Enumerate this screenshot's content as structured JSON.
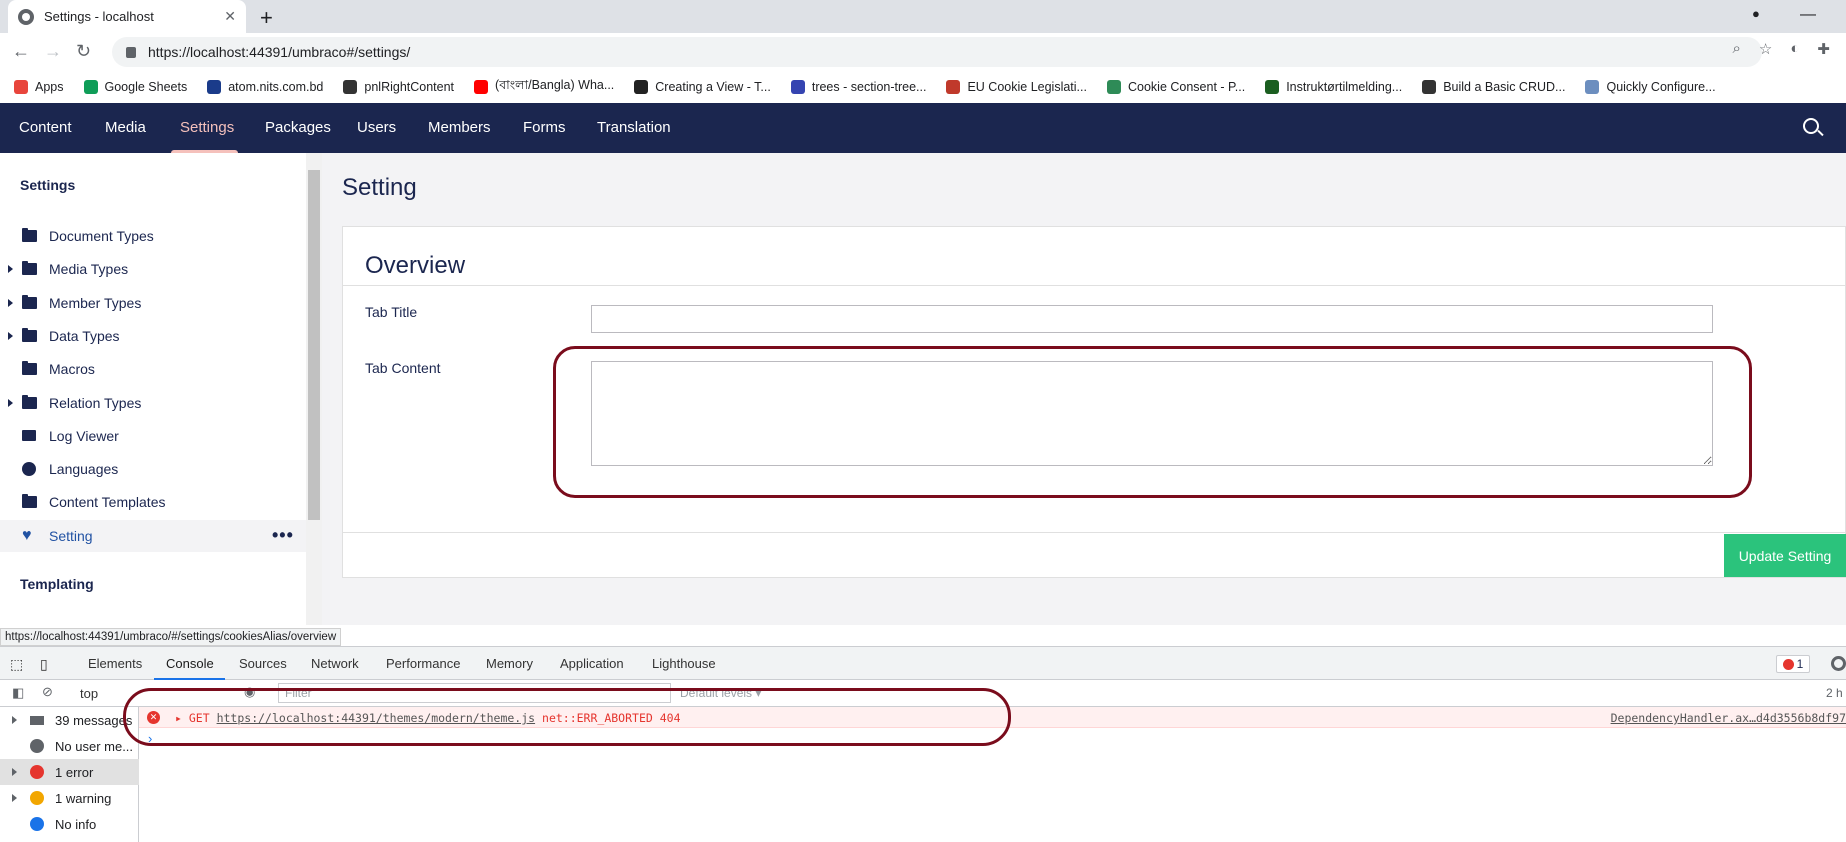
{
  "browser": {
    "tab_title": "Settings - localhost",
    "url": "https://localhost:44391/umbraco#/settings/",
    "bookmarks": [
      {
        "label": "Apps",
        "icon": "apps-grid-icon",
        "color": "#e8453c"
      },
      {
        "label": "Google Sheets",
        "icon": "google-sheets-icon",
        "color": "#0f9d58"
      },
      {
        "label": "atom.nits.com.bd",
        "icon": "atom-n-icon",
        "color": "#1a3b8a"
      },
      {
        "label": "pnlRightContent",
        "icon": "asp-icon",
        "color": "#333333"
      },
      {
        "label": "(বাংলা/Bangla) Wha...",
        "icon": "youtube-icon",
        "color": "#ff0000"
      },
      {
        "label": "Creating a View - T...",
        "icon": "graduation-cap-icon",
        "color": "#222222"
      },
      {
        "label": "trees - section-tree...",
        "icon": "umbraco-icon",
        "color": "#3544b1"
      },
      {
        "label": "EU Cookie Legislati...",
        "icon": "code-icon",
        "color": "#c0392b"
      },
      {
        "label": "Cookie Consent - P...",
        "icon": "p-icon",
        "color": "#2e8b57"
      },
      {
        "label": "Instruktørtilmelding...",
        "icon": "infinity-icon",
        "color": "#1b5e20"
      },
      {
        "label": "Build a Basic CRUD...",
        "icon": "braces-icon",
        "color": "#333333"
      },
      {
        "label": "Quickly Configure...",
        "icon": "cloud-icon",
        "color": "#6c8ebf"
      }
    ]
  },
  "header": {
    "sections": [
      "Content",
      "Media",
      "Settings",
      "Packages",
      "Users",
      "Members",
      "Forms",
      "Translation"
    ],
    "active": "Settings"
  },
  "sidebar": {
    "title": "Settings",
    "items": [
      {
        "label": "Document Types",
        "icon": "folder-icon",
        "expandable": false
      },
      {
        "label": "Media Types",
        "icon": "folder-icon",
        "expandable": true
      },
      {
        "label": "Member Types",
        "icon": "folder-icon",
        "expandable": true
      },
      {
        "label": "Data Types",
        "icon": "folder-icon",
        "expandable": true
      },
      {
        "label": "Macros",
        "icon": "folder-icon",
        "expandable": false
      },
      {
        "label": "Relation Types",
        "icon": "folder-icon",
        "expandable": true
      },
      {
        "label": "Log Viewer",
        "icon": "box-icon",
        "expandable": false
      },
      {
        "label": "Languages",
        "icon": "globe-icon",
        "expandable": false
      },
      {
        "label": "Content Templates",
        "icon": "folder-icon",
        "expandable": false
      },
      {
        "label": "Setting",
        "icon": "heart-icon",
        "expandable": false,
        "active": true
      }
    ],
    "more_label": "•••",
    "subsection": "Templating"
  },
  "main": {
    "page_title": "Setting",
    "panel_title": "Overview",
    "fields": [
      {
        "label": "Tab Title",
        "value": ""
      },
      {
        "label": "Tab Content",
        "value": ""
      }
    ],
    "update_button": "Update Setting"
  },
  "status_url": "https://localhost:44391/umbraco/#/settings/cookiesAlias/overview",
  "devtools": {
    "tabs": [
      "Elements",
      "Console",
      "Sources",
      "Network",
      "Performance",
      "Memory",
      "Application",
      "Lighthouse"
    ],
    "active_tab": "Console",
    "error_count": "1",
    "context": "top",
    "filter_placeholder": "Filter",
    "levels": "Default levels ▾",
    "sidebar": [
      {
        "label": "39 messages",
        "icon": "list-icon",
        "color": "#5f6368"
      },
      {
        "label": "No user me...",
        "icon": "user-icon",
        "color": "#5f6368"
      },
      {
        "label": "1 error",
        "icon": "error-icon",
        "color": "#e5352e",
        "selected": true
      },
      {
        "label": "1 warning",
        "icon": "warning-icon",
        "color": "#f2a600"
      },
      {
        "label": "No info",
        "icon": "info-icon",
        "color": "#1a73e8"
      }
    ],
    "error": {
      "method": "GET",
      "url": "https://localhost:44391/themes/modern/theme.js",
      "message": "net::ERR_ABORTED 404",
      "source": "DependencyHandler.ax…d4d3556b8df97"
    },
    "right_clip": "2 h"
  }
}
